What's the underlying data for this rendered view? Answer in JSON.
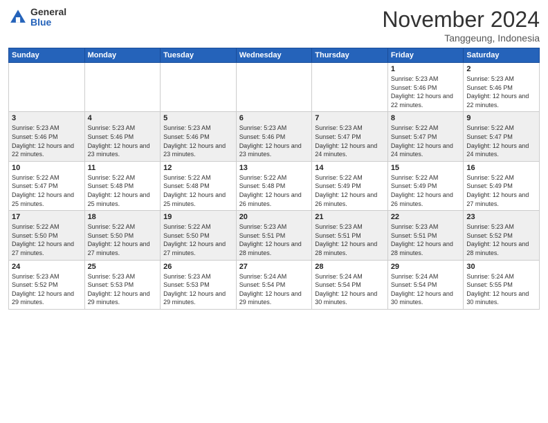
{
  "header": {
    "logo_general": "General",
    "logo_blue": "Blue",
    "month_title": "November 2024",
    "location": "Tanggeung, Indonesia"
  },
  "weekdays": [
    "Sunday",
    "Monday",
    "Tuesday",
    "Wednesday",
    "Thursday",
    "Friday",
    "Saturday"
  ],
  "weeks": [
    [
      {
        "day": "",
        "info": ""
      },
      {
        "day": "",
        "info": ""
      },
      {
        "day": "",
        "info": ""
      },
      {
        "day": "",
        "info": ""
      },
      {
        "day": "",
        "info": ""
      },
      {
        "day": "1",
        "info": "Sunrise: 5:23 AM\nSunset: 5:46 PM\nDaylight: 12 hours and 22 minutes."
      },
      {
        "day": "2",
        "info": "Sunrise: 5:23 AM\nSunset: 5:46 PM\nDaylight: 12 hours and 22 minutes."
      }
    ],
    [
      {
        "day": "3",
        "info": "Sunrise: 5:23 AM\nSunset: 5:46 PM\nDaylight: 12 hours and 22 minutes."
      },
      {
        "day": "4",
        "info": "Sunrise: 5:23 AM\nSunset: 5:46 PM\nDaylight: 12 hours and 23 minutes."
      },
      {
        "day": "5",
        "info": "Sunrise: 5:23 AM\nSunset: 5:46 PM\nDaylight: 12 hours and 23 minutes."
      },
      {
        "day": "6",
        "info": "Sunrise: 5:23 AM\nSunset: 5:46 PM\nDaylight: 12 hours and 23 minutes."
      },
      {
        "day": "7",
        "info": "Sunrise: 5:23 AM\nSunset: 5:47 PM\nDaylight: 12 hours and 24 minutes."
      },
      {
        "day": "8",
        "info": "Sunrise: 5:22 AM\nSunset: 5:47 PM\nDaylight: 12 hours and 24 minutes."
      },
      {
        "day": "9",
        "info": "Sunrise: 5:22 AM\nSunset: 5:47 PM\nDaylight: 12 hours and 24 minutes."
      }
    ],
    [
      {
        "day": "10",
        "info": "Sunrise: 5:22 AM\nSunset: 5:47 PM\nDaylight: 12 hours and 25 minutes."
      },
      {
        "day": "11",
        "info": "Sunrise: 5:22 AM\nSunset: 5:48 PM\nDaylight: 12 hours and 25 minutes."
      },
      {
        "day": "12",
        "info": "Sunrise: 5:22 AM\nSunset: 5:48 PM\nDaylight: 12 hours and 25 minutes."
      },
      {
        "day": "13",
        "info": "Sunrise: 5:22 AM\nSunset: 5:48 PM\nDaylight: 12 hours and 26 minutes."
      },
      {
        "day": "14",
        "info": "Sunrise: 5:22 AM\nSunset: 5:49 PM\nDaylight: 12 hours and 26 minutes."
      },
      {
        "day": "15",
        "info": "Sunrise: 5:22 AM\nSunset: 5:49 PM\nDaylight: 12 hours and 26 minutes."
      },
      {
        "day": "16",
        "info": "Sunrise: 5:22 AM\nSunset: 5:49 PM\nDaylight: 12 hours and 27 minutes."
      }
    ],
    [
      {
        "day": "17",
        "info": "Sunrise: 5:22 AM\nSunset: 5:50 PM\nDaylight: 12 hours and 27 minutes."
      },
      {
        "day": "18",
        "info": "Sunrise: 5:22 AM\nSunset: 5:50 PM\nDaylight: 12 hours and 27 minutes."
      },
      {
        "day": "19",
        "info": "Sunrise: 5:22 AM\nSunset: 5:50 PM\nDaylight: 12 hours and 27 minutes."
      },
      {
        "day": "20",
        "info": "Sunrise: 5:23 AM\nSunset: 5:51 PM\nDaylight: 12 hours and 28 minutes."
      },
      {
        "day": "21",
        "info": "Sunrise: 5:23 AM\nSunset: 5:51 PM\nDaylight: 12 hours and 28 minutes."
      },
      {
        "day": "22",
        "info": "Sunrise: 5:23 AM\nSunset: 5:51 PM\nDaylight: 12 hours and 28 minutes."
      },
      {
        "day": "23",
        "info": "Sunrise: 5:23 AM\nSunset: 5:52 PM\nDaylight: 12 hours and 28 minutes."
      }
    ],
    [
      {
        "day": "24",
        "info": "Sunrise: 5:23 AM\nSunset: 5:52 PM\nDaylight: 12 hours and 29 minutes."
      },
      {
        "day": "25",
        "info": "Sunrise: 5:23 AM\nSunset: 5:53 PM\nDaylight: 12 hours and 29 minutes."
      },
      {
        "day": "26",
        "info": "Sunrise: 5:23 AM\nSunset: 5:53 PM\nDaylight: 12 hours and 29 minutes."
      },
      {
        "day": "27",
        "info": "Sunrise: 5:24 AM\nSunset: 5:54 PM\nDaylight: 12 hours and 29 minutes."
      },
      {
        "day": "28",
        "info": "Sunrise: 5:24 AM\nSunset: 5:54 PM\nDaylight: 12 hours and 30 minutes."
      },
      {
        "day": "29",
        "info": "Sunrise: 5:24 AM\nSunset: 5:54 PM\nDaylight: 12 hours and 30 minutes."
      },
      {
        "day": "30",
        "info": "Sunrise: 5:24 AM\nSunset: 5:55 PM\nDaylight: 12 hours and 30 minutes."
      }
    ]
  ]
}
